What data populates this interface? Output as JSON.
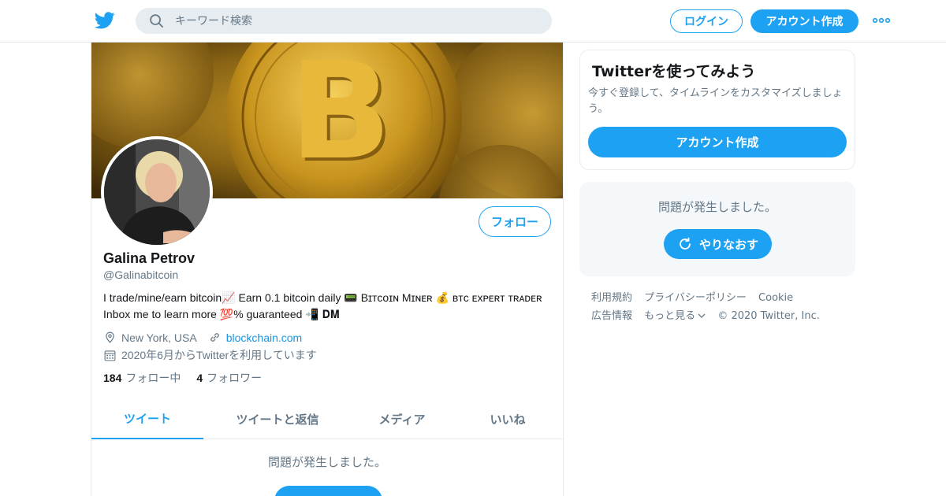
{
  "header": {
    "search_placeholder": "キーワード検索",
    "login_label": "ログイン",
    "signup_label": "アカウント作成"
  },
  "profile": {
    "name": "Galina Petrov",
    "handle": "@Galinabitcoin",
    "bio": "I trade/mine/earn bitcoin📈 Earn 0.1 bitcoin daily 📟 Bɪᴛᴄᴏɪɴ Mɪɴᴇʀ 💰 ʙᴛᴄ ᴇxᴘᴇʀᴛ ᴛʀᴀᴅᴇʀ Inbox me to learn more 💯% guaranteed 📲 𝐃𝐌",
    "location": "New York, USA",
    "website": "blockchain.com",
    "joined": "2020年6月からTwitterを利用しています",
    "following_count": "184",
    "following_label": "フォロー中",
    "followers_count": "4",
    "followers_label": "フォロワー",
    "follow_button": "フォロー"
  },
  "tabs": [
    "ツイート",
    "ツイートと返信",
    "メディア",
    "いいね"
  ],
  "main_error": "問題が発生しました。",
  "sidebar": {
    "card_title": "Twitterを使ってみよう",
    "card_desc": "今すぐ登録して、タイムラインをカスタマイズしましょう。",
    "card_button": "アカウント作成",
    "error_msg": "問題が発生しました。",
    "retry_button": "やりなおす"
  },
  "footer": {
    "links": [
      "利用規約",
      "プライバシーポリシー",
      "Cookie",
      "広告情報"
    ],
    "more": "もっと見る",
    "copyright": "© 2020 Twitter, Inc."
  },
  "colors": {
    "accent": "#1da1f2",
    "secondary_text": "#657786"
  }
}
